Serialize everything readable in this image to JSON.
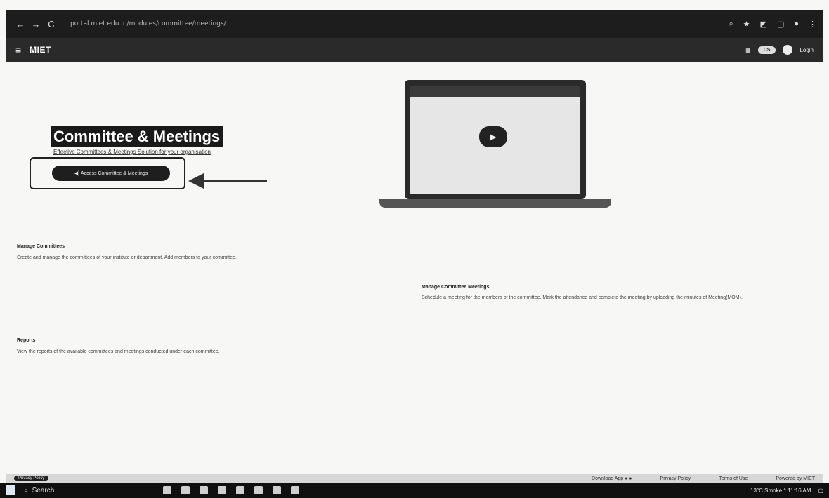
{
  "browser": {
    "back": "←",
    "forward": "→",
    "reload": "C",
    "url": "portal.miet.edu.in/modules/committee/meetings/"
  },
  "app": {
    "menu": "≡",
    "name": "MIET",
    "right": {
      "pill": "CS",
      "user_label": "Login"
    }
  },
  "hero": {
    "title": "Committee & Meetings",
    "subtitle": "Effective Committees & Meetings Solution for your organisation",
    "button": "◀) Access Committee & Meetings"
  },
  "features": [
    {
      "title": "Manage Committees",
      "desc": "Create and manage the committees of your institute or department. Add members to your committee."
    },
    {
      "title": "Manage Committee Meetings",
      "desc": "Schedule a meeting for the members of the committee. Mark the attendance and complete the meeting by uploading the minutes of Meeting(MOM)."
    },
    {
      "title": "Reports",
      "desc": "View the reports of the available committees and meetings conducted under each committee."
    }
  ],
  "footer": {
    "chip": "Privacy Policy",
    "links": [
      "Download App ● ●",
      "Privacy Policy",
      "Terms of Use",
      "Powered by MIET"
    ]
  },
  "taskbar": {
    "search": "Search",
    "tray": "13°C Smoke   ^   11:16 AM"
  }
}
